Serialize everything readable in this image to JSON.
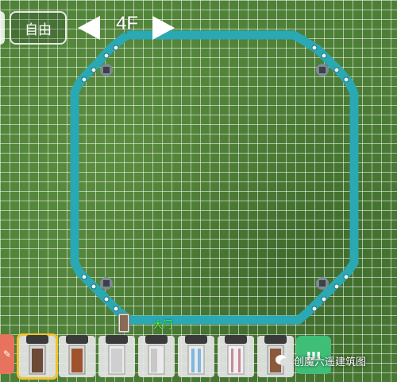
{
  "hud": {
    "mode_label": "自由",
    "floor_label": "4F"
  },
  "plan": {
    "door_label": "大门",
    "wall_color": "#2aa8b4",
    "grid_color": "#ffffff"
  },
  "toolbar": {
    "selected_slot": 0,
    "slots": [
      "door-icon",
      "door-icon",
      "door-icon",
      "door-icon",
      "door-icon",
      "door-icon",
      "door-icon"
    ]
  },
  "watermark": {
    "text": "创魔六遥建筑图"
  },
  "colors": {
    "selected_outline": "#f2c230",
    "more_button": "#3fbe78",
    "edit_tool": "#e8735c"
  }
}
